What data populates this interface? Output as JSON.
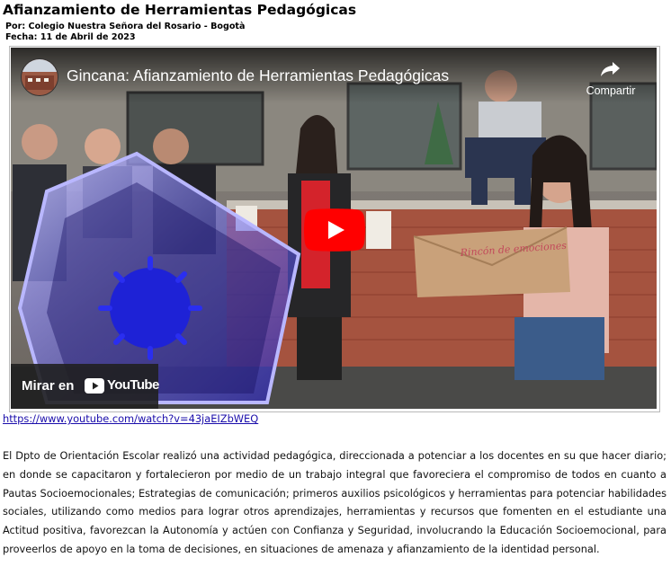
{
  "article": {
    "title": "Afianzamiento de Herramientas Pedagógicas",
    "author_line": "Por: Colegio Nuestra Señora del Rosario - Bogotà",
    "date_line": "Fecha: 11 de Abril de 2023"
  },
  "video": {
    "title": "Gincana: Afianzamiento de Herramientas Pedagógicas",
    "share_label": "Compartir",
    "watch_on": "Mirar en",
    "youtube_brand": "YouTube",
    "sign_text": "Rincón de emociones",
    "accent_color": "#ff0000"
  },
  "link": {
    "url_text": "https://www.youtube.com/watch?v=43jaEIZbWEQ"
  },
  "body_text": "El Dpto de Orientación Escolar realizó una actividad pedagógica, direccionada a potenciar a los docentes en su que hacer diario; en donde se capacitaron y fortalecieron por medio de un trabajo integral que favoreciera el compromiso de todos en cuanto a Pautas Socioemocionales; Estrategias de comunicación; primeros auxilios psicológicos y herramientas para potenciar habilidades sociales, utilizando como medios para lograr otros aprendizajes, herramientas y recursos que fomenten en el estudiante una Actitud positiva, favorezcan la Autonomía y actúen con Confianza y Seguridad, involucrando la Educación Socioemocional, para proveerlos de apoyo en la toma de decisiones, en situaciones de amenaza y afianzamiento de la identidad personal."
}
